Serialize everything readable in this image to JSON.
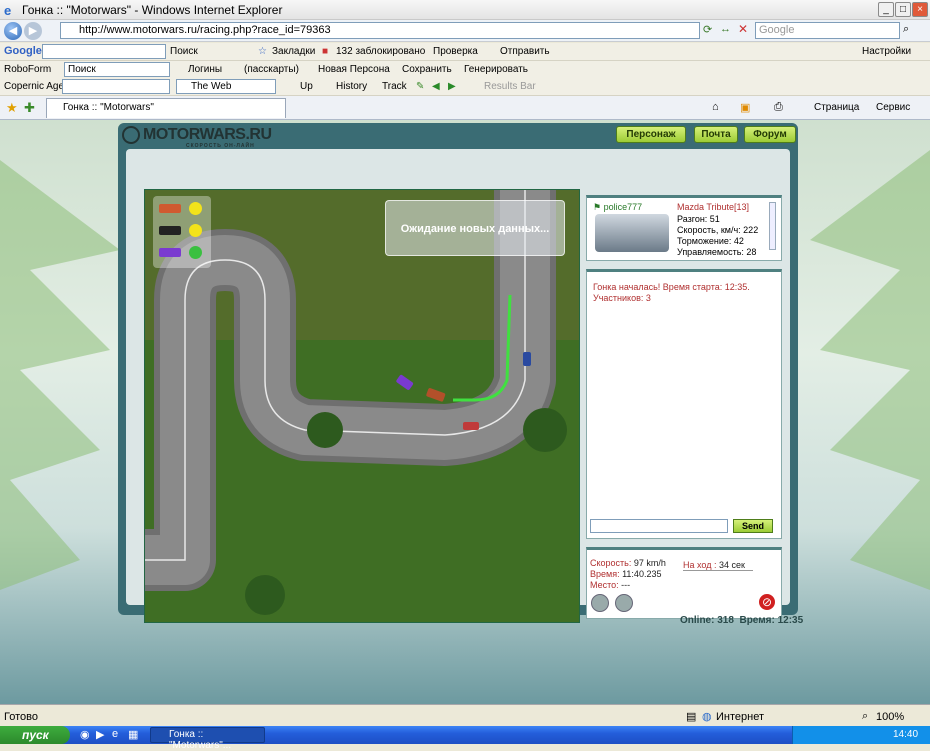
{
  "window": {
    "title": "Гонка :: \"Motorwars\" - Windows Internet Explorer"
  },
  "address": {
    "url": "http://www.motorwars.ru/racing.php?race_id=79363",
    "search_placeholder": "Google"
  },
  "google_bar": {
    "logo": "Google",
    "search_label": "Поиск",
    "bookmarks": "Закладки",
    "blocked": "132 заблокировано",
    "check": "Проверка",
    "send": "Отправить",
    "settings": "Настройки"
  },
  "roboform_bar": {
    "name": "RoboForm",
    "search": "Поиск",
    "logins": "Логины",
    "passcards": "(пасскарты)",
    "new_persona": "Новая Персона",
    "save": "Сохранить",
    "generate": "Генерировать"
  },
  "copernic_bar": {
    "name": "Copernic Agent",
    "scope": "The Web",
    "up": "Up",
    "history": "History",
    "track": "Track",
    "results": "Results Bar"
  },
  "tabbar": {
    "tab_title": "Гонка :: \"Motorwars\"",
    "page": "Страница",
    "service": "Сервис"
  },
  "site": {
    "logo": "MOTORWARS.RU",
    "tagline": "СКОРОСТЬ ОН-ЛАЙН",
    "nav": [
      "Персонаж",
      "Почта",
      "Форум"
    ]
  },
  "race": {
    "waiting": "Ожидание новых данных..."
  },
  "opponent": {
    "user": "police777",
    "car": "Mazda Tribute",
    "level": "[13]",
    "stats": [
      "Разгон: 51",
      "Скорость, км/ч: 222",
      "Торможение: 42",
      "Управляемость: 28"
    ]
  },
  "chat": {
    "messages": [
      "Гонка началась! Время старта: 12:35.",
      "Участников: 3"
    ],
    "send": "Send"
  },
  "status": {
    "speed_label": "Скорость:",
    "speed": "97 km/h",
    "time_label": "Время:",
    "time": "11:40.235",
    "place_label": "Место:",
    "place": "---",
    "turn_label": "На ход :",
    "turn": "34 сек"
  },
  "footer": {
    "online": "Online: 318",
    "time": "Время: 12:35"
  },
  "ie_status": {
    "ready": "Готово",
    "zone": "Интернет",
    "zoom": "100%"
  },
  "taskbar": {
    "start": "пуск",
    "task": "Гонка :: \"Motorwars\"...",
    "clock": "14:40"
  },
  "colors": {
    "accent": "#3a6c74",
    "grass": "#3f6e24",
    "road": "#7b7b7b",
    "nav": "#9ccc35"
  }
}
